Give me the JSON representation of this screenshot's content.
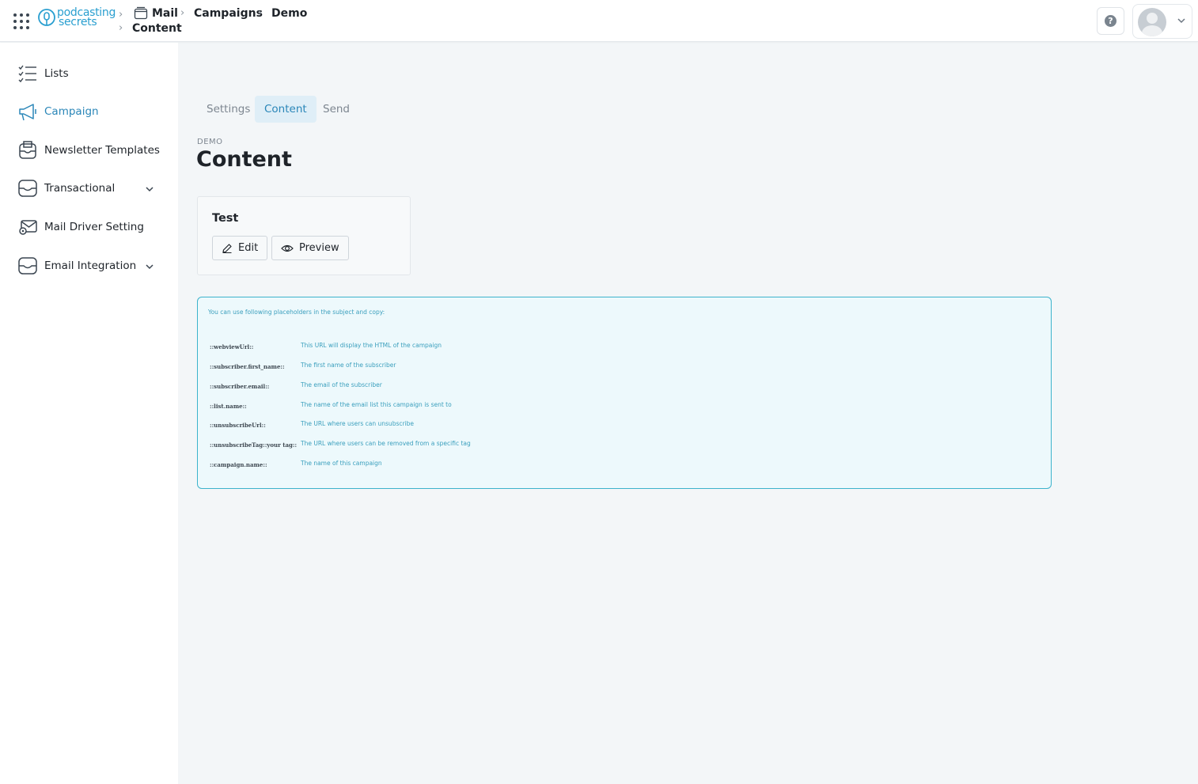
{
  "header": {
    "logo_line1": "podcasting",
    "logo_line2": "secrets",
    "breadcrumb": [
      "Mail",
      "Campaigns",
      "Demo",
      "Content"
    ]
  },
  "sidebar": {
    "items": [
      {
        "label": "Lists",
        "icon": "list-check-icon"
      },
      {
        "label": "Campaign",
        "icon": "megaphone-icon",
        "active": true
      },
      {
        "label": "Newsletter Templates",
        "icon": "newsletter-icon"
      },
      {
        "label": "Transactional",
        "icon": "inbox-icon",
        "expandable": true
      },
      {
        "label": "Mail Driver Setting",
        "icon": "mail-settings-icon"
      },
      {
        "label": "Email Integration",
        "icon": "inbox-icon",
        "expandable": true
      }
    ]
  },
  "tabs": [
    {
      "label": "Settings"
    },
    {
      "label": "Content",
      "active": true
    },
    {
      "label": "Send"
    }
  ],
  "page": {
    "eyebrow": "DEMO",
    "title": "Content"
  },
  "card": {
    "title": "Test",
    "edit_label": "Edit",
    "preview_label": "Preview"
  },
  "placeholders": {
    "intro": "You can use following placeholders in the subject and copy:",
    "rows": [
      {
        "key": "::webviewUrl::",
        "desc": "This URL will display the HTML of the campaign"
      },
      {
        "key": "::subscriber.first_name::",
        "desc": "The first name of the subscriber"
      },
      {
        "key": "::subscriber.email::",
        "desc": "The email of the subscriber"
      },
      {
        "key": "::list.name::",
        "desc": "The name of the email list this campaign is sent to"
      },
      {
        "key": "::unsubscribeUrl::",
        "desc": "The URL where users can unsubscribe"
      },
      {
        "key": "::unsubscribeTag::your tag::",
        "desc": "The URL where users can be removed from a specific tag"
      },
      {
        "key": "::campaign.name::",
        "desc": "The name of this campaign"
      }
    ]
  },
  "colors": {
    "accent": "#2a86b8",
    "info_border": "#3cb3cc",
    "info_bg": "#edf9fc"
  }
}
